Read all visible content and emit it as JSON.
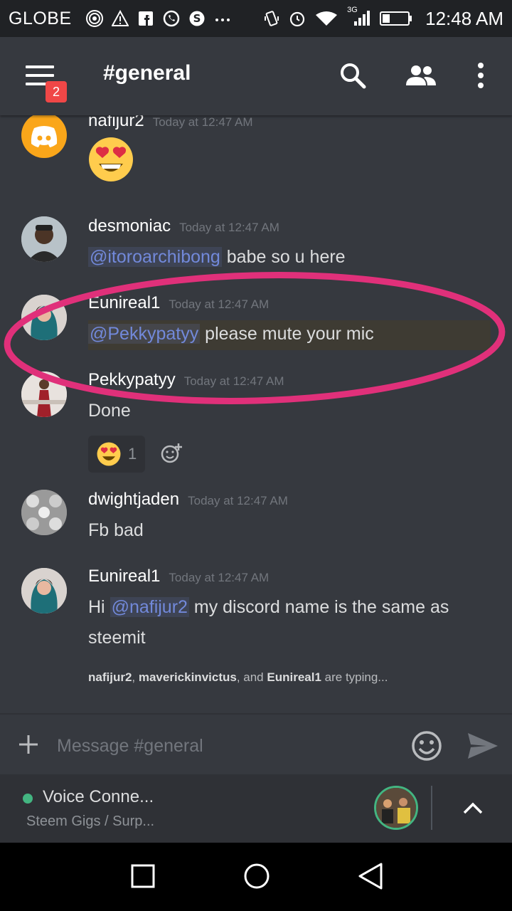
{
  "status_bar": {
    "carrier": "GLOBE",
    "network_badge": "3G",
    "time": "12:48 AM",
    "icons_left": [
      "hotspot-icon",
      "warning-icon",
      "facebook-icon",
      "whatsapp-icon",
      "skype-icon",
      "more-dots-icon"
    ],
    "icons_right": [
      "vibrate-icon",
      "alarm-icon",
      "wifi-icon",
      "signal-icon",
      "battery-icon"
    ]
  },
  "header": {
    "channel": "#general",
    "unread_badge": "2"
  },
  "messages": [
    {
      "author": "nafijur2",
      "timestamp": "Today at 12:47 AM",
      "emoji": "heart-eyes-emoji"
    },
    {
      "author": "desmoniac",
      "timestamp": "Today at 12:47 AM",
      "mention": "@itoroarchibong",
      "text": " babe so u here"
    },
    {
      "author": "Eunireal1",
      "timestamp": "Today at 12:47 AM",
      "mention": "@Pekkypatyy",
      "text": " please mute your mic"
    },
    {
      "author": "Pekkypatyy",
      "timestamp": "Today at 12:47 AM",
      "text": "Done",
      "reaction_count": "1"
    },
    {
      "author": "dwightjaden",
      "timestamp": "Today at 12:47 AM",
      "text": "Fb bad"
    },
    {
      "author": "Eunireal1",
      "timestamp": "Today at 12:47 AM",
      "pre": "Hi ",
      "mention": "@nafijur2",
      "text": " my discord name is the same as",
      "text2": "steemit"
    }
  ],
  "typing": {
    "user1": "nafijur2",
    "sep1": ", ",
    "user2": "maverickinvictus",
    "sep2": ", and ",
    "user3": "Eunireal1",
    "suffix": " are typing..."
  },
  "composer": {
    "placeholder": "Message #general"
  },
  "voice": {
    "title": "Voice Conne...",
    "subtitle": "Steem Gigs / Surp..."
  },
  "colors": {
    "background": "#36393f",
    "header": "#36393f",
    "mention": "#7289da",
    "accent_pink": "#e0307a",
    "voice_green": "#43b581",
    "badge_red": "#f04747"
  }
}
